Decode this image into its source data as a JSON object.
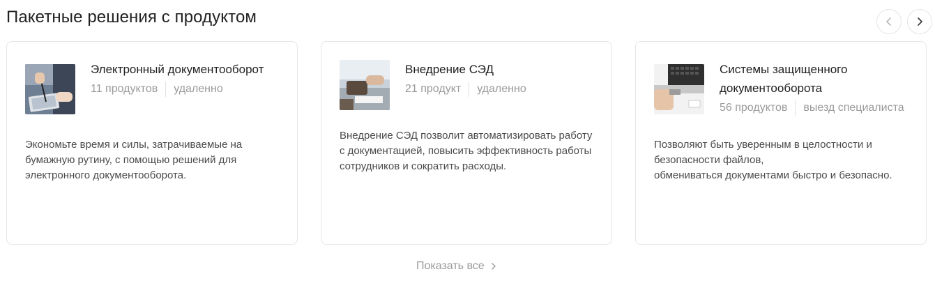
{
  "section": {
    "title": "Пакетные решения с продуктом"
  },
  "nav": {
    "prev_icon": "chevron-left-icon",
    "next_icon": "chevron-right-icon"
  },
  "cards": [
    {
      "title": "Электронный документооборот",
      "products": "11 продуктов",
      "mode": "удаленно",
      "description": "Экономьте время и силы, затрачиваемые на бумажную рутину, с помощью решений для электронного документооборота.",
      "image": "tablet-signing-photo"
    },
    {
      "title": "Внедрение СЭД",
      "products": "21 продукт",
      "mode": "удаленно",
      "description": "Внедрение СЭД позволит автоматизировать работу с документацией, повысить эффективность работы сотрудников и сократить расходы.",
      "image": "office-meeting-photo"
    },
    {
      "title": "Системы защищенного документооборота",
      "products": "56 продуктов",
      "mode": "выезд специалиста",
      "description_lines": [
        "Позволяют быть уверенным в целостности и безопасности файлов,",
        "обмениваться  документами быстро и безопасно."
      ],
      "image": "usb-key-laptop-photo"
    }
  ],
  "footer": {
    "show_all_label": "Показать все"
  },
  "colors": {
    "muted": "#9a9a9a",
    "border": "#e6e6e6",
    "text": "#1f1f1f"
  }
}
